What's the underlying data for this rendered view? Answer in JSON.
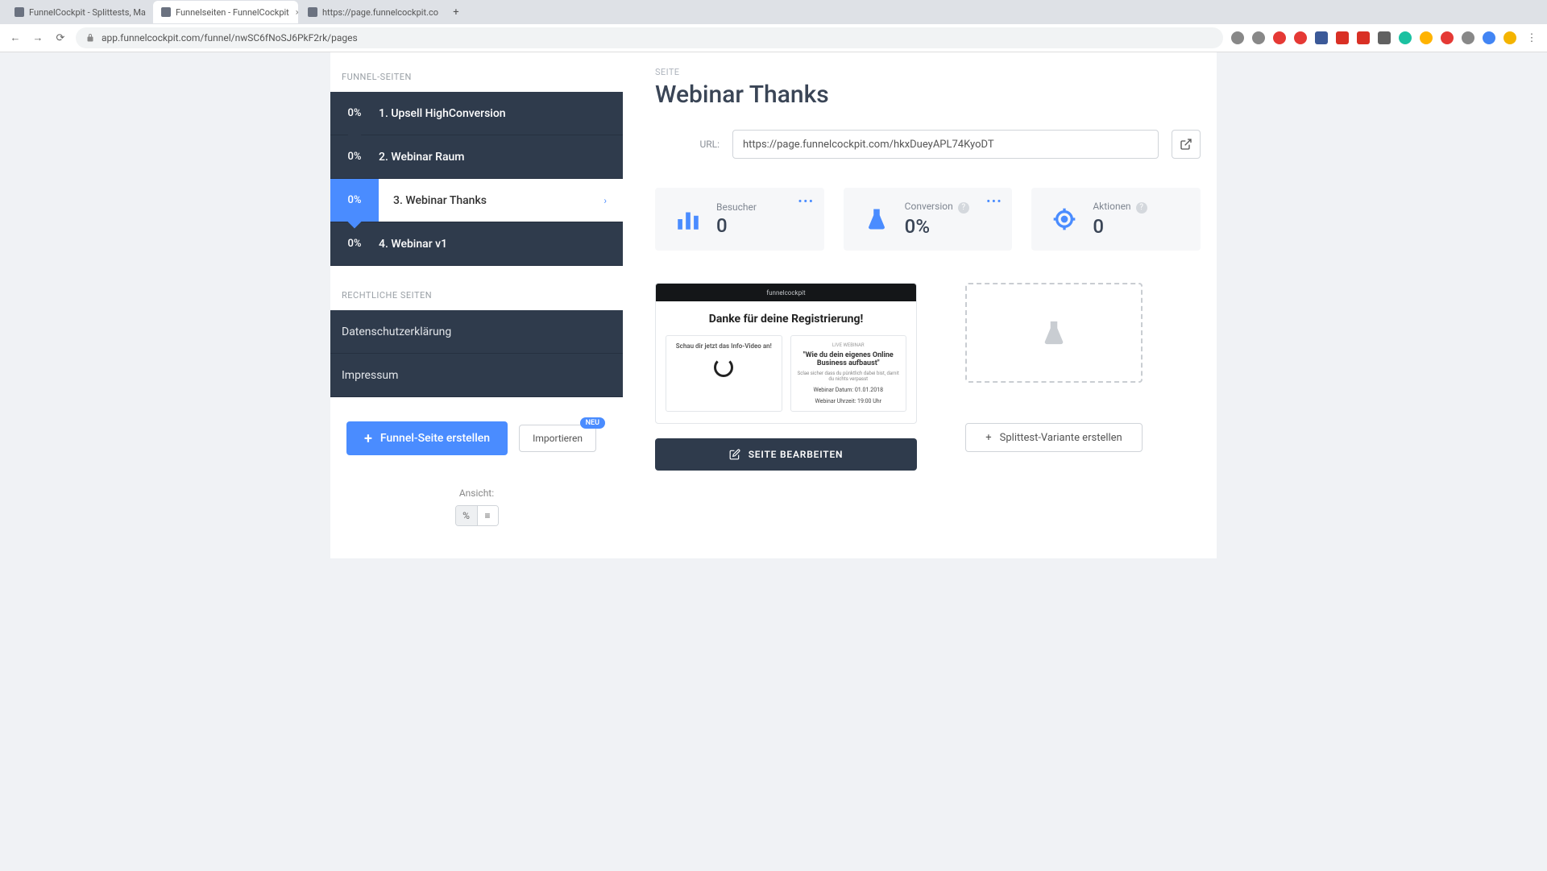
{
  "browser": {
    "tabs": [
      {
        "title": "FunnelCockpit - Splittests, Ma",
        "active": false
      },
      {
        "title": "Funnelseiten - FunnelCockpit",
        "active": true
      },
      {
        "title": "https://page.funnelcockpit.co",
        "active": false
      }
    ],
    "url": "app.funnelcockpit.com/funnel/nwSC6fNoSJ6PkF2rk/pages"
  },
  "sidebar": {
    "section1_label": "FUNNEL-SEITEN",
    "pages": [
      {
        "pct": "0%",
        "label": "1. Upsell HighConversion",
        "active": false
      },
      {
        "pct": "0%",
        "label": "2. Webinar Raum",
        "active": false
      },
      {
        "pct": "0%",
        "label": "3. Webinar Thanks",
        "active": true
      },
      {
        "pct": "0%",
        "label": "4. Webinar v1",
        "active": false
      }
    ],
    "section2_label": "RECHTLICHE SEITEN",
    "legal": [
      {
        "label": "Datenschutzerklärung"
      },
      {
        "label": "Impressum"
      }
    ],
    "create_btn": "Funnel-Seite erstellen",
    "import_btn": "Importieren",
    "badge_new": "NEU",
    "view_label": "Ansicht:"
  },
  "main": {
    "eyebrow": "SEITE",
    "title": "Webinar Thanks",
    "url_label": "URL:",
    "url_value": "https://page.funnelcockpit.com/hkxDueyAPL74KyoDT",
    "stats": [
      {
        "label": "Besucher",
        "value": "0",
        "menu": true,
        "help": false,
        "icon": "bars"
      },
      {
        "label": "Conversion",
        "value": "0%",
        "menu": true,
        "help": true,
        "icon": "flask"
      },
      {
        "label": "Aktionen",
        "value": "0",
        "menu": false,
        "help": true,
        "icon": "target"
      }
    ],
    "preview": {
      "brand": "funnelcockpit",
      "headline": "Danke für deine Registrierung!",
      "left_title": "Schau dir jetzt das Info-Video an!",
      "right_eyebrow": "LIVE WEBINAR",
      "right_quote": "\"Wie du dein eigenes Online Business aufbaust\"",
      "right_sub": "Sclae sicher dass du pünktlich dabei bist, damit du nichts verpasst",
      "right_date": "Webinar Datum: 01.01.2018",
      "right_time": "Webinar Uhrzeit: 19:00 Uhr"
    },
    "edit_btn": "SEITE BEARBEITEN",
    "split_btn": "Splittest-Variante erstellen"
  }
}
